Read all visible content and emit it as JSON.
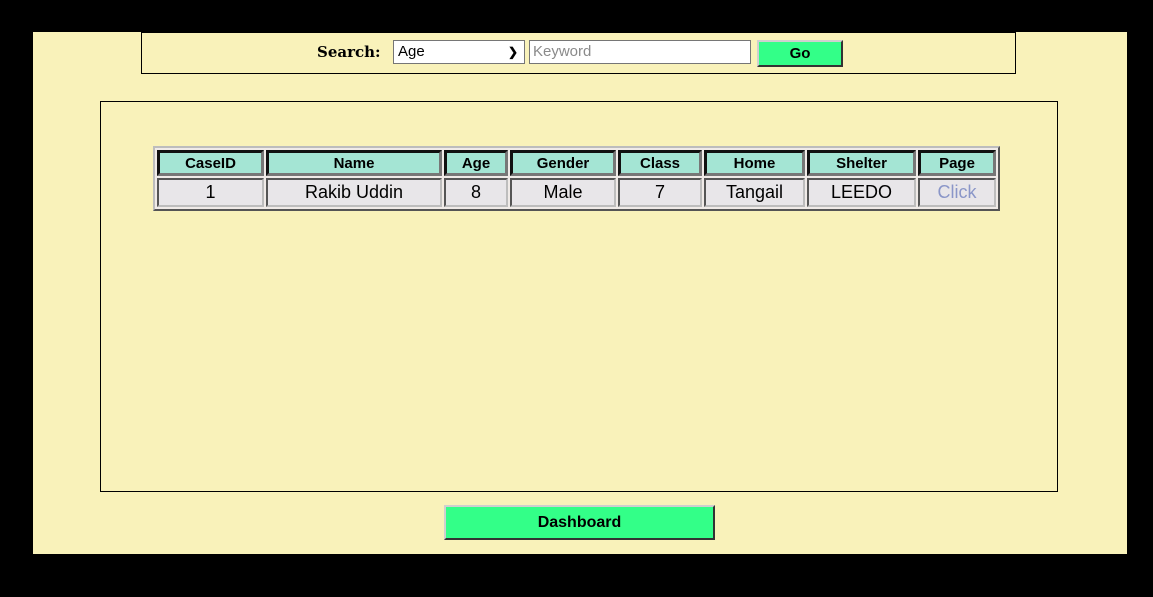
{
  "search": {
    "label": "Search:",
    "select_value": "Age",
    "select_options": [
      "Age"
    ],
    "keyword_placeholder": "Keyword",
    "keyword_value": "",
    "go_label": "Go"
  },
  "table": {
    "headers": {
      "caseid": "CaseID",
      "name": "Name",
      "age": "Age",
      "gender": "Gender",
      "class": "Class",
      "home": "Home",
      "shelter": "Shelter",
      "page": "Page"
    },
    "rows": [
      {
        "caseid": "1",
        "name": "Rakib Uddin",
        "age": "8",
        "gender": "Male",
        "class": "7",
        "home": "Tangail",
        "shelter": "LEEDO",
        "page": "Click"
      }
    ]
  },
  "footer": {
    "dashboard_label": "Dashboard"
  },
  "colors": {
    "background": "#f9f2ba",
    "accent_button": "#33ff88",
    "header_cell": "#a4e5d4",
    "link": "#8a96c8"
  }
}
